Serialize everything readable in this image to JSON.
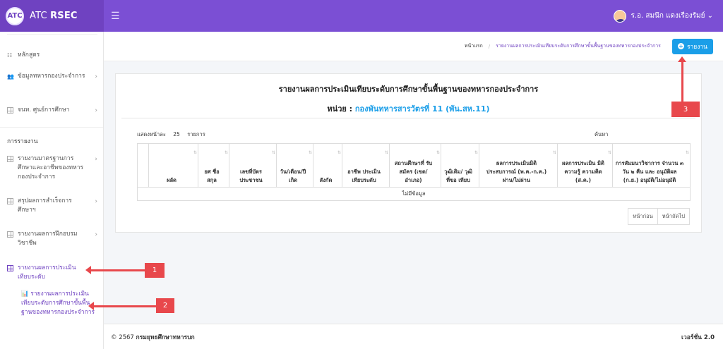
{
  "brand": {
    "logo_text": "ATC",
    "name_plain": "ATC ",
    "name_bold": "RSEC"
  },
  "user": {
    "name": "ร.อ. สมนึก แดงเรืองรัมย์ ⌄"
  },
  "sidebar": {
    "items": [
      {
        "label": "หลักสูตร",
        "icon": "list-icon"
      },
      {
        "label": "ข้อมูลทหารกองประจำการ",
        "icon": "users-icon"
      },
      {
        "label": "จนท. ศูนย์การศึกษา",
        "icon": "grid-icon"
      },
      {
        "label": "รายงานมาตรฐานการศึกษาและอาชีพของทหารกองประจำการ",
        "icon": "grid-icon"
      },
      {
        "label": "สรุปผลการสำเร็จการศึกษาฯ",
        "icon": "grid-icon"
      },
      {
        "label": "รายงานผลการฝึกอบรมวิชาชีพ",
        "icon": "grid-icon"
      },
      {
        "label": "รายงานผลการประเมินเทียบระดับ",
        "icon": "grid-icon"
      }
    ],
    "section_title": "การรายงาน",
    "sub_item": "รายงานผลการประเมินเทียบระดับการศึกษาขั้นพื้นฐานของทหารกองประจำการ"
  },
  "breadcrumb": {
    "home": "หน้าแรก",
    "separator": "/",
    "current": "รายงานผลการประเมินเทียบระดับการศึกษาขั้นพื้นฐานของทหารกองประจำการ"
  },
  "report_button": {
    "label": "รายงาน"
  },
  "report": {
    "title": "รายงานผลการประเมินเทียบระดับการศึกษาขั้นพื้นฐานของทหารกองประจำการ",
    "unit_label": "หน่วย : ",
    "unit_value": "กองพันทหารสารวัตรที่ 11 (พัน.สห.11)",
    "show_label": "แสดงหน้าละ",
    "show_count": "25",
    "show_suffix": "รายการ",
    "search_label": "ค้นหา",
    "columns": [
      "",
      "ผลัด",
      "ยศ ชื่อ สกุล",
      "เลขที่บัตรประชาชน",
      "วัน/เดือน/ปี เกิด",
      "สังกัด",
      "อาชีพ ประเมิน เทียบระดับ",
      "สถานศึกษาที่ รับสมัคร (เขต/อำเภอ)",
      "วุฒิเดิม/ วุฒิที่ขอ เทียบ",
      "ผลการประเมินมิติ ประสบการณ์ (พ.ค.-ก.ค.) ผ่าน/ไม่ผ่าน",
      "ผลการประเมิน มิติความรู้ ความคิด (ส.ค.)",
      "การสัมมนาวิชาการ จำนวน ๓ วัน ๒ คืน และ อนุมัติผล (ก.ย.) อนุมัติ/ไม่อนุมัติ"
    ],
    "empty_text": "ไม่มีข้อมูล",
    "prev": "หน้าก่อน",
    "next": "หน้าถัดไป"
  },
  "footer": {
    "copyright": "© 2567 ",
    "org": "กรมยุทธศึกษาทหารบก",
    "version": "เวอร์ชั่น 2.0"
  },
  "annotations": {
    "a1": "1",
    "a2": "2",
    "a3": "3"
  },
  "colors": {
    "purple": "#6f42c1",
    "topbar": "#7b4fd4",
    "blue": "#1a9ee8",
    "annotation": "#e8484c"
  }
}
